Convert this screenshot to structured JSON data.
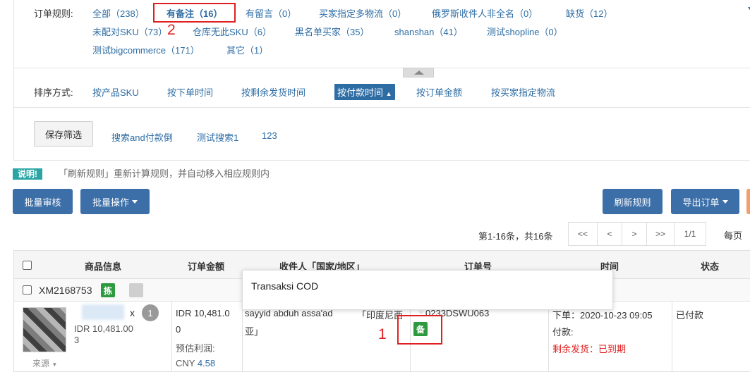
{
  "rules": {
    "label": "订单规则:",
    "items": [
      "全部（238）",
      "有备注（16）",
      "有留言（0）",
      "买家指定多物流（0）",
      "俄罗斯收件人非全名（0）",
      "缺货（12）",
      "未配对SKU（73）",
      "仓库无此SKU（6）",
      "黑名单买家（35）",
      "shanshan（41）",
      "测试shopline（0）",
      "测试bigcommerce（171）",
      "其它（1）"
    ]
  },
  "sort": {
    "label": "排序方式:",
    "options": [
      "按产品SKU",
      "按下单时间",
      "按剩余发货时间",
      "按付款时间",
      "按订单金额",
      "按买家指定物流"
    ],
    "active_index": 3
  },
  "saved": {
    "save_button": "保存筛选",
    "items": [
      "搜索and付款倒",
      "测试搜索1",
      "123"
    ]
  },
  "notice": {
    "badge": "说明!",
    "text": "「刷新规则」重新计算规则，并自动移入相应规则内"
  },
  "actions": {
    "batch_audit": "批量审核",
    "batch_ops": "批量操作",
    "refresh_rules": "刷新规则",
    "export_orders": "导出订单"
  },
  "pagination": {
    "info": "第1-16条，共16条",
    "first": "<<",
    "prev": "<",
    "next": ">",
    "last": ">>",
    "page": "1/1",
    "per_page_label": "每页"
  },
  "table": {
    "headers": [
      "商品信息",
      "订单金额",
      "收件人「国家/地区」",
      "订单号",
      "时间",
      "状态"
    ],
    "group": {
      "id": "XM2168753",
      "tag": "拣"
    },
    "row": {
      "qty_prefix": "x",
      "qty": "1",
      "product_price": "IDR 10,481.00",
      "product_extra": "3",
      "source": "来源",
      "amount_line1": "IDR 10,481.0",
      "amount_line2": "0",
      "profit_label": "预估利润:",
      "profit_value_prefix": "CNY ",
      "profit_value": "4.58",
      "recipient_name": "sayyid abduh assa'ad",
      "recipient_country": "「印度尼西",
      "recipient_country2": "亚」",
      "order_no": "0233DSWU063",
      "remark_tag": "备",
      "time_order": "下单：2020-10-23 09:05",
      "time_paid": "付款:",
      "time_remaining": "剩余发货：已到期",
      "status": "已付款"
    }
  },
  "tooltip": {
    "text": "Transaksi COD"
  },
  "annotations": {
    "label_1": "1",
    "label_2": "2"
  },
  "colors": {
    "link": "#2e6da4",
    "primary_button": "#3c6fa8",
    "annotation_red": "#e02020",
    "tag_green": "#2e9a3f",
    "notice_teal": "#2aa4a4"
  }
}
